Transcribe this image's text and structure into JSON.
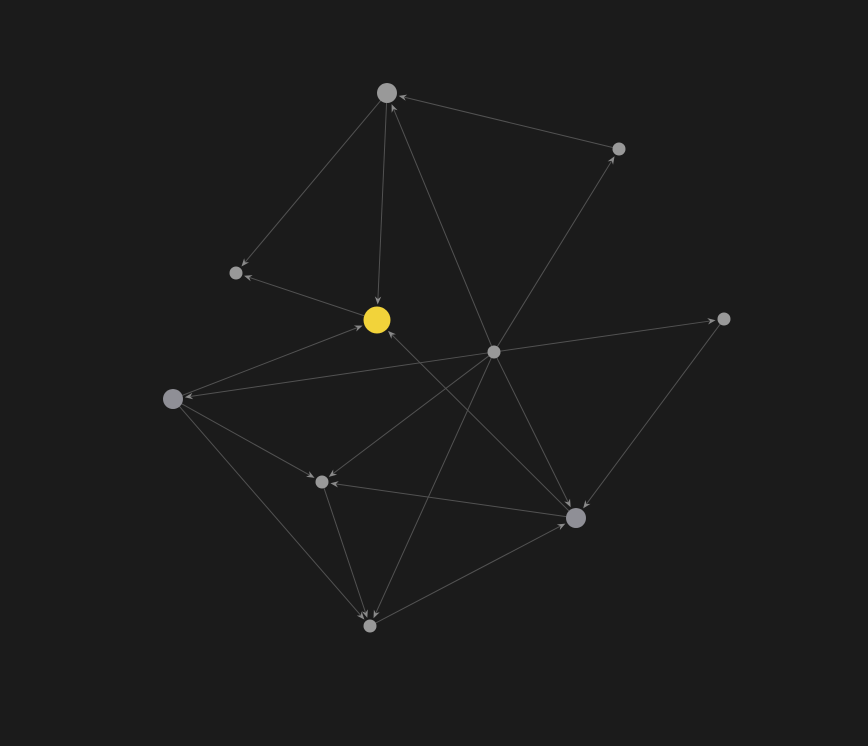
{
  "graph": {
    "background": "#1b1b1b",
    "colors": {
      "edge": "#525252",
      "arrow": "#8a8a8a",
      "node_default": "#999999",
      "node_muted": "#8f8f96",
      "node_active": "#f2d33a"
    },
    "nodes": [
      {
        "id": "n0"
      },
      {
        "id": "n1"
      },
      {
        "id": "n2"
      },
      {
        "id": "n3",
        "active": true
      },
      {
        "id": "n4"
      },
      {
        "id": "n5"
      },
      {
        "id": "n6"
      },
      {
        "id": "n7"
      },
      {
        "id": "n8"
      },
      {
        "id": "n9"
      }
    ],
    "edges": [
      {
        "from": "n1",
        "to": "n0"
      },
      {
        "from": "n0",
        "to": "n2"
      },
      {
        "from": "n0",
        "to": "n3"
      },
      {
        "from": "n4",
        "to": "n0"
      },
      {
        "from": "n4",
        "to": "n1"
      },
      {
        "from": "n3",
        "to": "n2"
      },
      {
        "from": "n4",
        "to": "n5"
      },
      {
        "from": "n4",
        "to": "n6"
      },
      {
        "from": "n6",
        "to": "n3"
      },
      {
        "from": "n4",
        "to": "n7"
      },
      {
        "from": "n4",
        "to": "n8"
      },
      {
        "from": "n4",
        "to": "n9"
      },
      {
        "from": "n5",
        "to": "n8"
      },
      {
        "from": "n8",
        "to": "n3"
      },
      {
        "from": "n6",
        "to": "n7"
      },
      {
        "from": "n6",
        "to": "n9"
      },
      {
        "from": "n8",
        "to": "n7"
      },
      {
        "from": "n7",
        "to": "n9"
      },
      {
        "from": "n9",
        "to": "n8"
      }
    ]
  }
}
